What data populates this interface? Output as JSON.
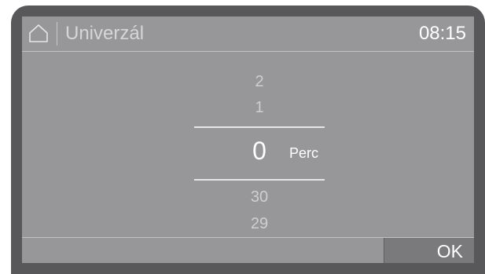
{
  "header": {
    "home_icon": "home-icon",
    "title": "Univerzál",
    "time": "08:15"
  },
  "picker": {
    "values_above": [
      "2",
      "1"
    ],
    "selected": "0",
    "unit": "Perc",
    "values_below": [
      "30",
      "29"
    ]
  },
  "footer": {
    "ok_label": "OK"
  },
  "colors": {
    "bezel": "#58585a",
    "screen": "#979799",
    "ok_button": "#7a7a7c"
  }
}
